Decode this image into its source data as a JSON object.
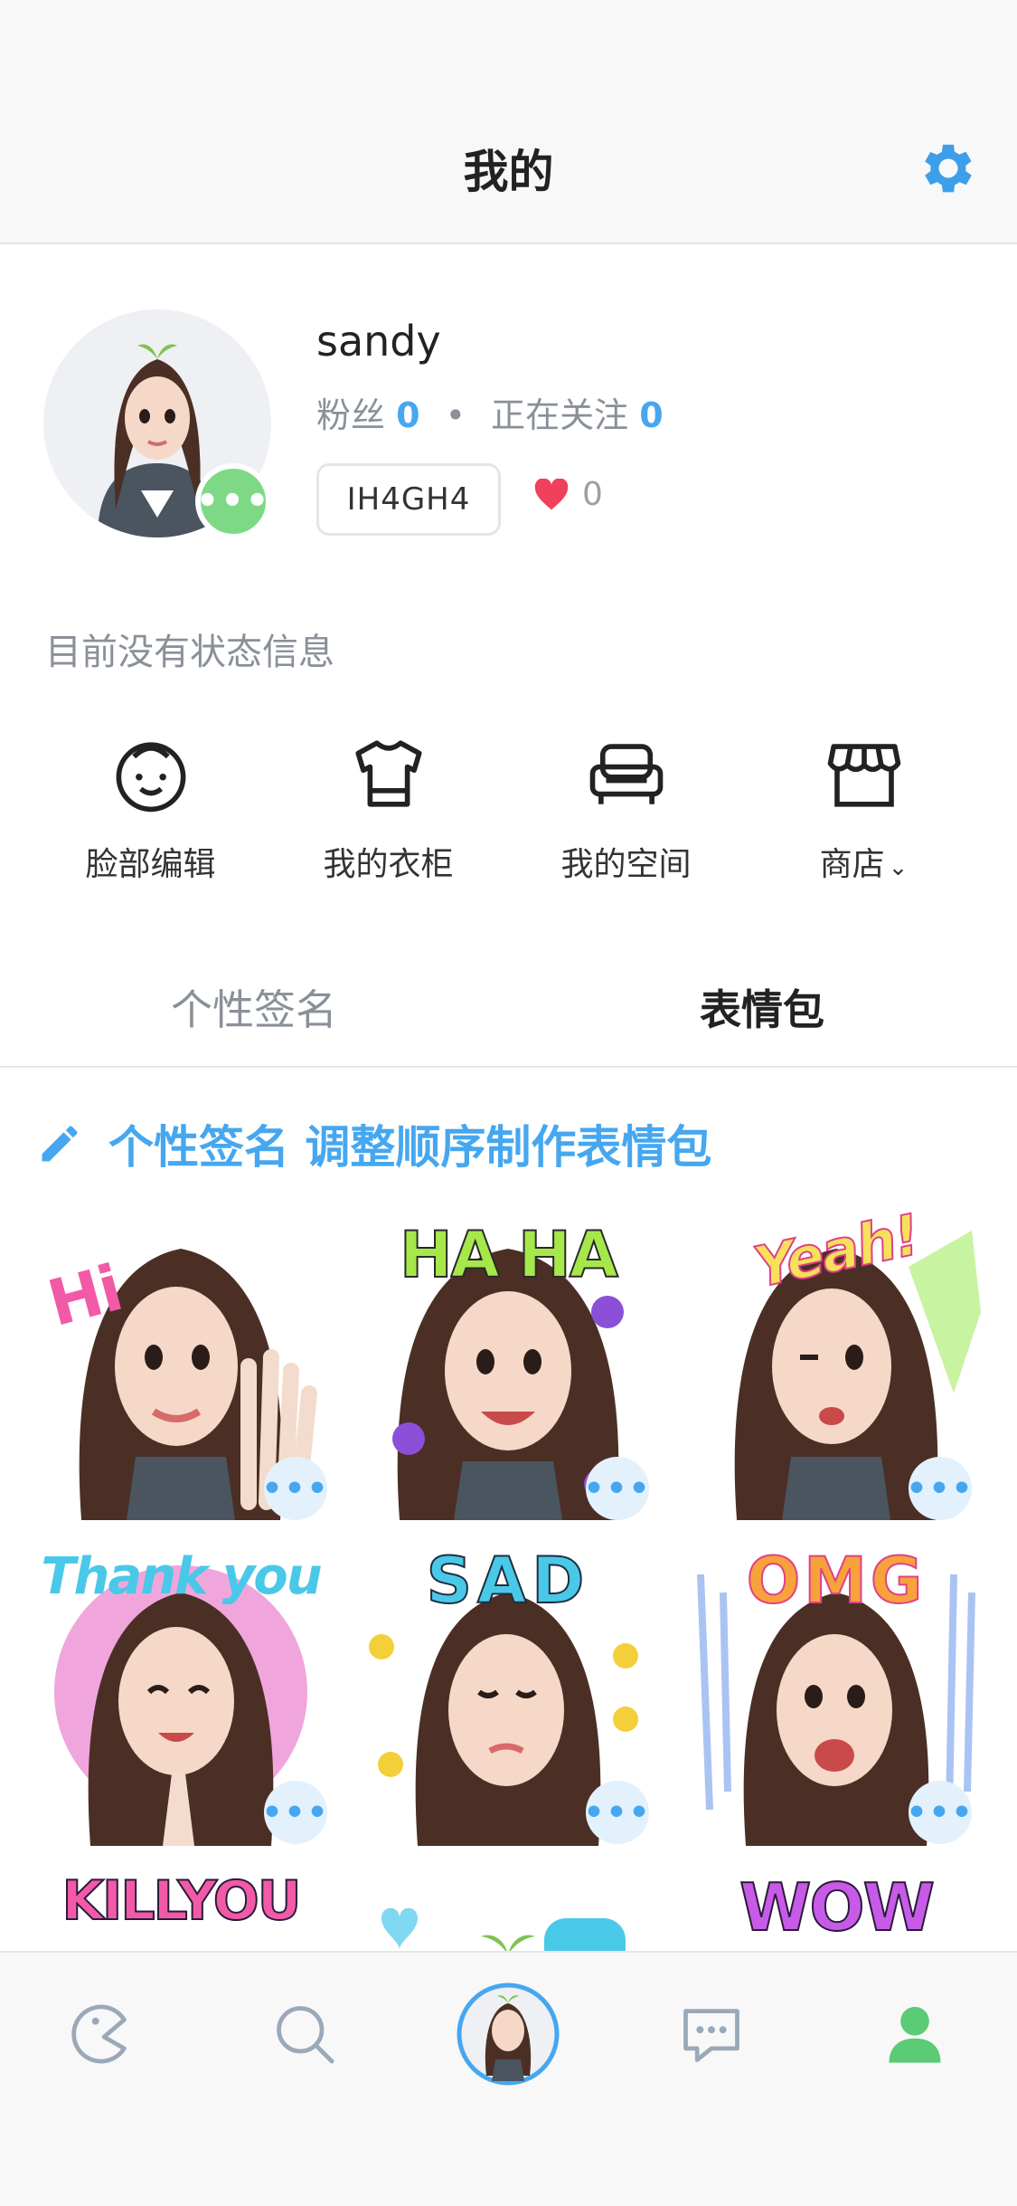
{
  "header": {
    "title": "我的",
    "settings_icon": "gear-icon"
  },
  "profile": {
    "username": "sandy",
    "followers_label": "粉丝",
    "followers_count": "0",
    "following_label": "正在关注",
    "following_count": "0",
    "separator": "•",
    "id_code": "IH4GH4",
    "likes_count": "0",
    "status_text": "目前没有状态信息",
    "status_dot": "•••"
  },
  "menu": [
    {
      "label": "脸部编辑",
      "icon": "face-icon"
    },
    {
      "label": "我的衣柜",
      "icon": "tshirt-icon"
    },
    {
      "label": "我的空间",
      "icon": "sofa-icon"
    },
    {
      "label": "商店",
      "icon": "store-icon",
      "suffix": "⌄"
    }
  ],
  "tabs": {
    "left": "个性签名",
    "right": "表情包"
  },
  "action": {
    "text": "个性签名 调整顺序制作表情包"
  },
  "stickers": [
    {
      "caption": "Hi"
    },
    {
      "caption": "HA HA"
    },
    {
      "caption": "Yeah!"
    },
    {
      "caption": "Thank you"
    },
    {
      "caption": "SAD"
    },
    {
      "caption": "OMG"
    },
    {
      "caption": "KILLYOU"
    },
    {
      "caption": ""
    },
    {
      "caption": "WOW"
    }
  ],
  "more_button_label": "•••",
  "colors": {
    "accent": "#46a7f0",
    "online": "#7ed987",
    "heart": "#f0405c",
    "nav_active": "#5ccb75"
  }
}
